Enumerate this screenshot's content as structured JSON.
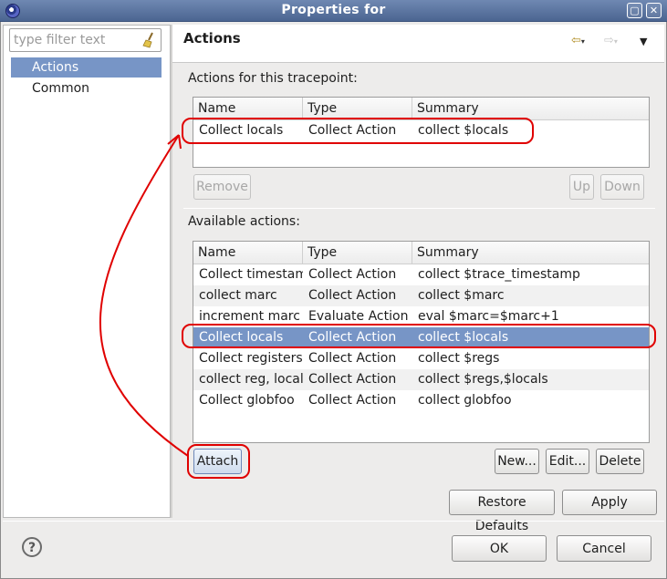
{
  "window": {
    "title": "Properties for"
  },
  "filter": {
    "placeholder": "type filter text"
  },
  "nav": {
    "items": [
      {
        "label": "Actions"
      },
      {
        "label": "Common"
      }
    ]
  },
  "page": {
    "title": "Actions"
  },
  "tracepoint_actions": {
    "label": "Actions for this tracepoint:",
    "columns": [
      "Name",
      "Type",
      "Summary"
    ],
    "rows": [
      [
        "Collect locals",
        "Collect Action",
        "collect $locals"
      ]
    ],
    "buttons": {
      "remove": "Remove",
      "up": "Up",
      "down": "Down"
    }
  },
  "available_actions": {
    "label": "Available actions:",
    "columns": [
      "Name",
      "Type",
      "Summary"
    ],
    "rows": [
      [
        "Collect timestamp",
        "Collect Action",
        "collect $trace_timestamp"
      ],
      [
        "collect marc",
        "Collect Action",
        "collect $marc"
      ],
      [
        "increment marc",
        "Evaluate Action",
        "eval $marc=$marc+1"
      ],
      [
        "Collect locals",
        "Collect Action",
        "collect $locals"
      ],
      [
        "Collect registers",
        "Collect Action",
        "collect $regs"
      ],
      [
        "collect reg, locals",
        "Collect Action",
        "collect $regs,$locals"
      ],
      [
        "Collect globfoo",
        "Collect Action",
        "collect globfoo"
      ]
    ],
    "selected_row": 3,
    "buttons": {
      "attach": "Attach",
      "new": "New...",
      "edit": "Edit...",
      "delete": "Delete"
    }
  },
  "page_buttons": {
    "restore_defaults": "Restore Defaults",
    "apply": "Apply"
  },
  "dialog_buttons": {
    "ok": "OK",
    "cancel": "Cancel"
  },
  "icons": {
    "help": "?"
  },
  "colors": {
    "selection": "#7795c6",
    "annotation": "#e00000",
    "titlebar": "#5a73a0"
  }
}
